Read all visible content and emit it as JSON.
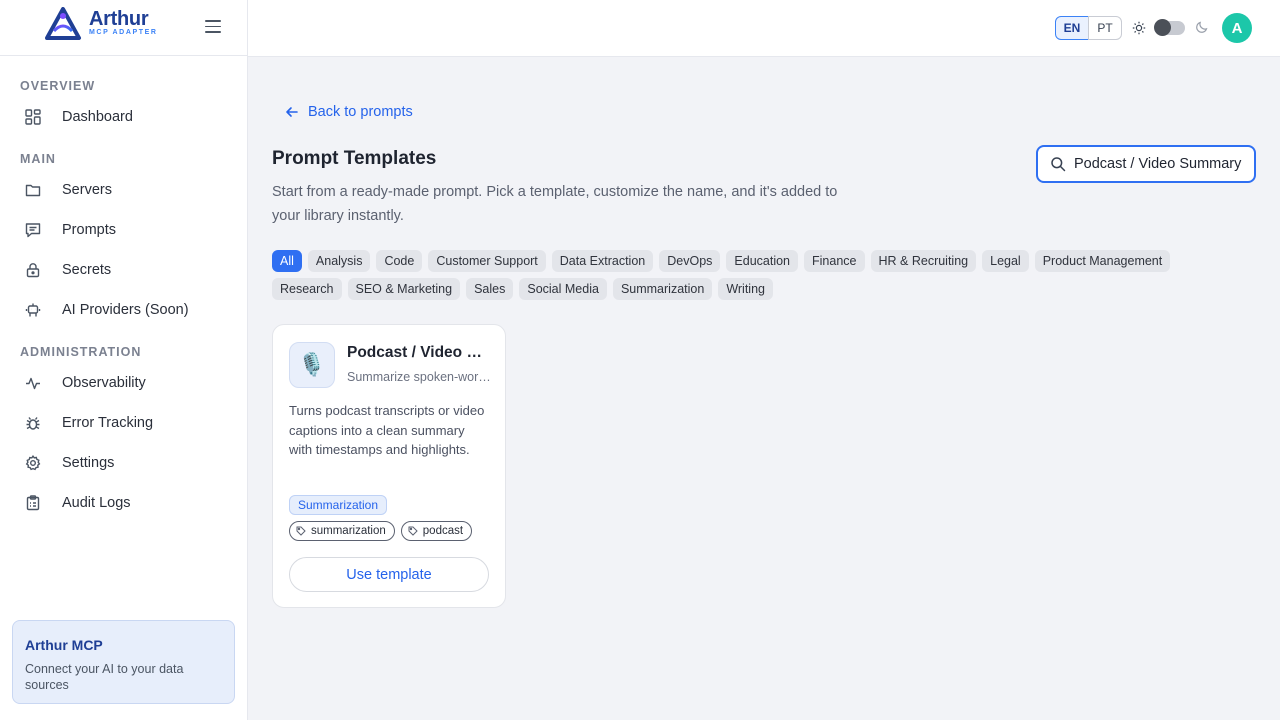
{
  "brand": {
    "name": "Arthur",
    "subtitle": "MCP ADAPTER"
  },
  "sidebar": {
    "sections": [
      {
        "label": "OVERVIEW"
      },
      {
        "label": "MAIN"
      },
      {
        "label": "ADMINISTRATION"
      }
    ],
    "items": [
      {
        "label": "Dashboard",
        "icon": "dashboard-icon"
      },
      {
        "label": "Servers",
        "icon": "folder-icon"
      },
      {
        "label": "Prompts",
        "icon": "message-icon"
      },
      {
        "label": "Secrets",
        "icon": "lock-icon"
      },
      {
        "label": "AI Providers (Soon)",
        "icon": "robot-icon"
      },
      {
        "label": "Observability",
        "icon": "activity-icon"
      },
      {
        "label": "Error Tracking",
        "icon": "bug-icon"
      },
      {
        "label": "Settings",
        "icon": "gear-icon"
      },
      {
        "label": "Audit Logs",
        "icon": "clipboard-icon"
      }
    ],
    "promo": {
      "title": "Arthur MCP",
      "text": "Connect your AI to your data sources"
    }
  },
  "header": {
    "lang_en": "EN",
    "lang_pt": "PT",
    "avatar_initial": "A"
  },
  "main": {
    "back_label": "Back to prompts",
    "title": "Prompt Templates",
    "description": "Start from a ready-made prompt. Pick a template, customize the name, and it's added to your library instantly.",
    "search_value": "Podcast / Video Summary",
    "categories": [
      "All",
      "Analysis",
      "Code",
      "Customer Support",
      "Data Extraction",
      "DevOps",
      "Education",
      "Finance",
      "HR & Recruiting",
      "Legal",
      "Product Management",
      "Research",
      "SEO & Marketing",
      "Sales",
      "Social Media",
      "Summarization",
      "Writing"
    ],
    "active_category": "All",
    "card": {
      "emoji": "🎙️",
      "title": "Podcast / Video Summary",
      "subtitle": "Summarize spoken-word content",
      "description": "Turns podcast transcripts or video captions into a clean summary with timestamps and highlights.",
      "category": "Summarization",
      "tags": [
        "summarization",
        "podcast"
      ],
      "button_label": "Use template"
    }
  },
  "colors": {
    "accent": "#2f6ff2",
    "brand": "#1f3f95",
    "avatar": "#1cc7a9"
  }
}
